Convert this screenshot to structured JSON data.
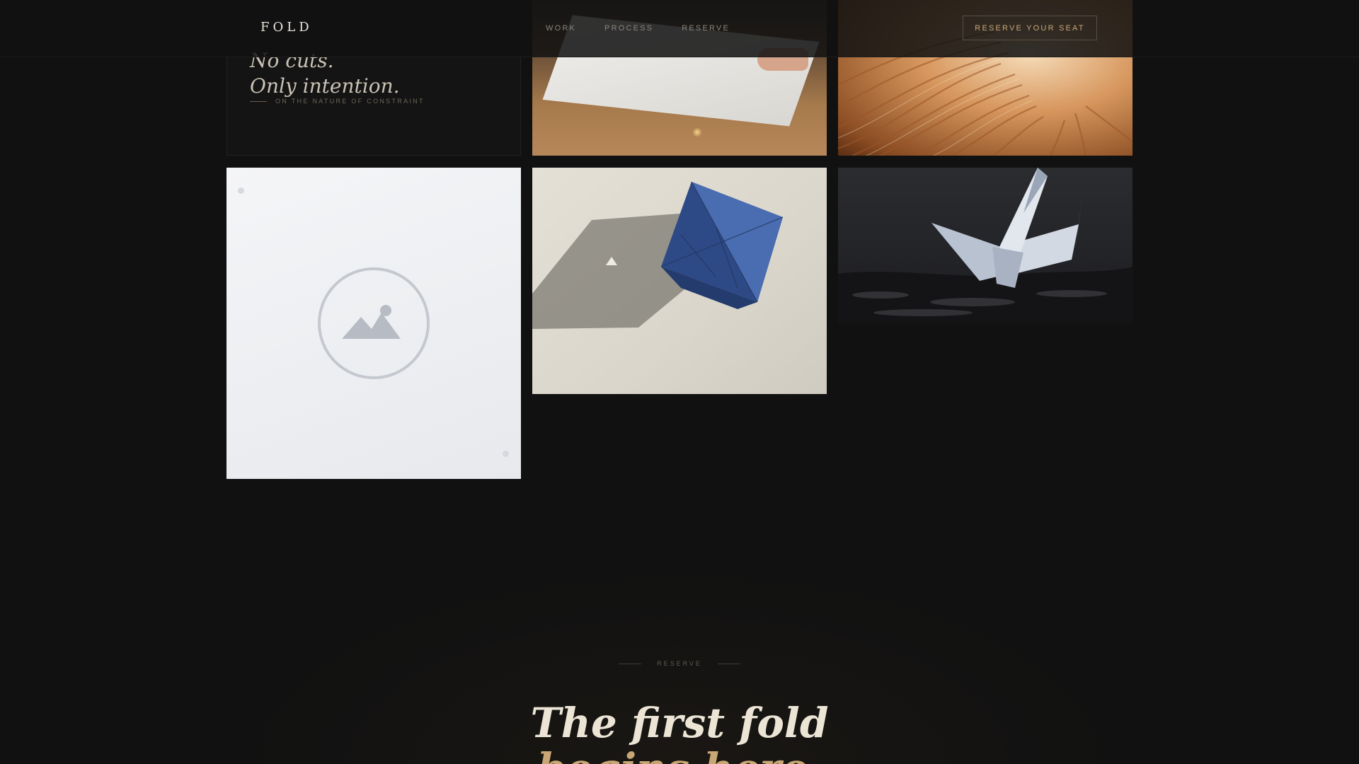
{
  "header": {
    "logo": "FOLD",
    "nav": [
      {
        "label": "WORK"
      },
      {
        "label": "PROCESS"
      },
      {
        "label": "RESERVE"
      }
    ],
    "cta_label": "RESERVE YOUR SEAT"
  },
  "gallery": {
    "quote": {
      "line1": "No cuts.",
      "line2": "Only intention.",
      "attribution": "ON THE NATURE OF CONSTRAINT"
    },
    "tiles": [
      {
        "icon": "paper-folding-photo"
      },
      {
        "icon": "copper-fold-photo"
      },
      {
        "icon": "image-placeholder-icon"
      },
      {
        "icon": "blue-origami-octahedron-photo"
      },
      {
        "icon": "paper-crane-photo"
      }
    ]
  },
  "reserve": {
    "eyebrow": "RESERVE",
    "headline_line1": "The first fold",
    "headline_line2": "begins here."
  },
  "colors": {
    "background": "#111111",
    "accent_gold": "#c9a774",
    "text_light": "#ece5d6",
    "muted": "#8a857c"
  }
}
